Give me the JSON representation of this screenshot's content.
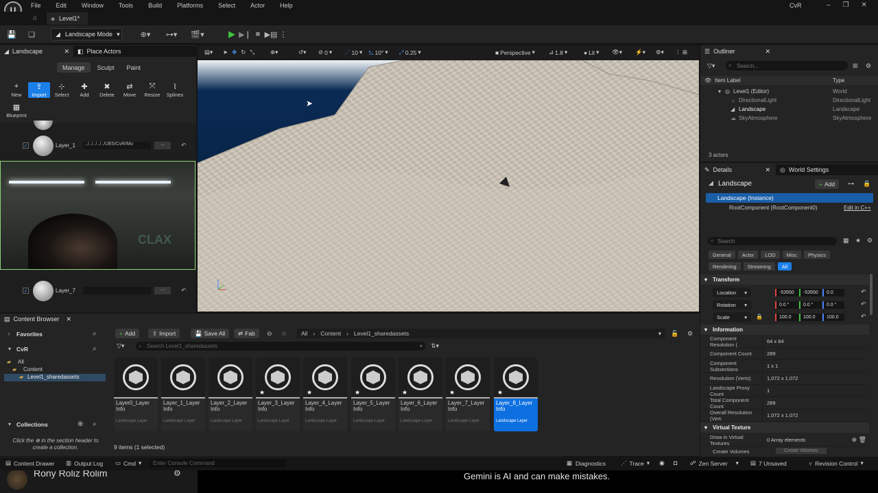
{
  "menu": [
    "File",
    "Edit",
    "Window",
    "Tools",
    "Build",
    "Platforms",
    "Select",
    "Actor",
    "Help"
  ],
  "project_name": "CvR",
  "level_tab": "Level1*",
  "toolbar": {
    "mode_label": "Landscape Mode"
  },
  "left_panel": {
    "tabs": [
      "Landscape",
      "Place Actors"
    ],
    "subtabs": [
      "Manage",
      "Sculpt",
      "Paint"
    ],
    "tools": [
      {
        "icon": "+",
        "label": "New"
      },
      {
        "icon": "⇪",
        "label": "Import"
      },
      {
        "icon": "⊹",
        "label": "Select"
      },
      {
        "icon": "✚",
        "label": "Add"
      },
      {
        "icon": "✖",
        "label": "Delete"
      },
      {
        "icon": "⇄",
        "label": "Move"
      },
      {
        "icon": "⤧",
        "label": "Resize"
      },
      {
        "icon": "⌇",
        "label": "Splines"
      },
      {
        "icon": "▦",
        "label": "Blueprint"
      }
    ],
    "layer1": {
      "name": "Layer_1",
      "path": "../../../../../UE5/CvR/Mo"
    },
    "layer7": {
      "name": "Layer_7"
    },
    "browse": "..."
  },
  "viewport": {
    "perspective": "Perspective",
    "fov": "1.8",
    "lit": "Lit",
    "grid_snap": "10",
    "rot_snap": "10°",
    "scale_snap": "0.25",
    "num0": "0"
  },
  "outliner": {
    "title": "Outliner",
    "search_placeholder": "Search...",
    "col_label": "Item Label",
    "col_type": "Type",
    "items": [
      {
        "label": "Level1 (Editor)",
        "type": "World"
      },
      {
        "label": "DirectionalLight",
        "type": "DirectionalLight"
      },
      {
        "label": "Landscape",
        "type": "Landscape"
      },
      {
        "label": "SkyAtmosphere",
        "type": "SkyAtmosphere"
      }
    ],
    "count": "3 actors"
  },
  "details": {
    "tabs": [
      "Details",
      "World Settings"
    ],
    "object": "Landscape",
    "add": "Add",
    "instance": "Landscape (Instance)",
    "root": "RootComponent (RootComponent0)",
    "edit_cpp": "Edit in C++",
    "search_placeholder": "Search",
    "filters": [
      "General",
      "Actor",
      "LOD",
      "Misc",
      "Physics",
      "Rendering",
      "Streaming",
      "All"
    ],
    "transform_title": "Transform",
    "location": {
      "label": "Location",
      "x": "-53550",
      "y": "-53550",
      "z": "0.0"
    },
    "rotation": {
      "label": "Rotation",
      "x": "0.0 °",
      "y": "0.0 °",
      "z": "0.0 °"
    },
    "scale": {
      "label": "Scale",
      "x": "100.0",
      "y": "100.0",
      "z": "100.0"
    },
    "info_title": "Information",
    "info": [
      {
        "k": "Component Resolution (",
        "v": "64 x 64"
      },
      {
        "k": "Component Count",
        "v": "289"
      },
      {
        "k": "Component Subsections",
        "v": "1 x 1"
      },
      {
        "k": "Resolution (Verts)",
        "v": "1,072 x 1,072"
      },
      {
        "k": "Landscape Proxy Count",
        "v": "1"
      },
      {
        "k": "Total Component Count",
        "v": "289"
      },
      {
        "k": "Overall Resolution (Vert:",
        "v": "1,072 x 1,072"
      }
    ],
    "vt_title": "Virtual Texture",
    "vt_draw": "Draw in Virtual Textures",
    "vt_draw_val": "0 Array elements",
    "vt_create": "Create Volumes",
    "vt_create_btn": "Create Volumes"
  },
  "content_browser": {
    "title": "Content Browser",
    "add": "Add",
    "import": "Import",
    "save_all": "Save All",
    "fab": "Fab",
    "path": [
      "All",
      "Content",
      "Level1_sharedassets"
    ],
    "search_placeholder": "Search Level1_sharedassets",
    "favorites": "Favorites",
    "project": "CvR",
    "tree": [
      "All",
      "Content",
      "Level1_sharedassets"
    ],
    "collections": "Collections",
    "collections_hint_a": "Click the",
    "collections_hint_b": "in the section header to create a collection.",
    "items": [
      {
        "name": "Layer0_Layer Info",
        "type": "Landscape Layer",
        "star": ""
      },
      {
        "name": "Layer_1_Layer Info",
        "type": "Landscape Layer",
        "star": ""
      },
      {
        "name": "Layer_2_Layer Info",
        "type": "Landscape Layer",
        "star": ""
      },
      {
        "name": "Layer_3_Layer Info",
        "type": "Landscape Layer",
        "star": "★"
      },
      {
        "name": "Layer_4_Layer Info",
        "type": "Landscape Layer",
        "star": "★"
      },
      {
        "name": "Layer_5_Layer Info",
        "type": "Landscape Layer",
        "star": "★"
      },
      {
        "name": "Layer_6_Layer Info",
        "type": "Landscape Layer",
        "star": "★"
      },
      {
        "name": "Layer_7_Layer Info",
        "type": "Landscape Layer",
        "star": "★"
      },
      {
        "name": "Layer_8_Layer Info",
        "type": "Landscape Layer",
        "star": "★"
      }
    ],
    "count": "9 items (1 selected)"
  },
  "statusbar": {
    "drawer": "Content Drawer",
    "output": "Output Log",
    "cmd": "Cmd",
    "console_placeholder": "Enter Console Command",
    "diagnostics": "Diagnostics",
    "trace": "Trace",
    "zen": "Zen Server",
    "unsaved": "7 Unsaved",
    "revision": "Revision Control"
  },
  "overlay": {
    "names": "Rony   Roliz   Rolim",
    "gemini": "Gemini is AI and can make mistakes."
  }
}
